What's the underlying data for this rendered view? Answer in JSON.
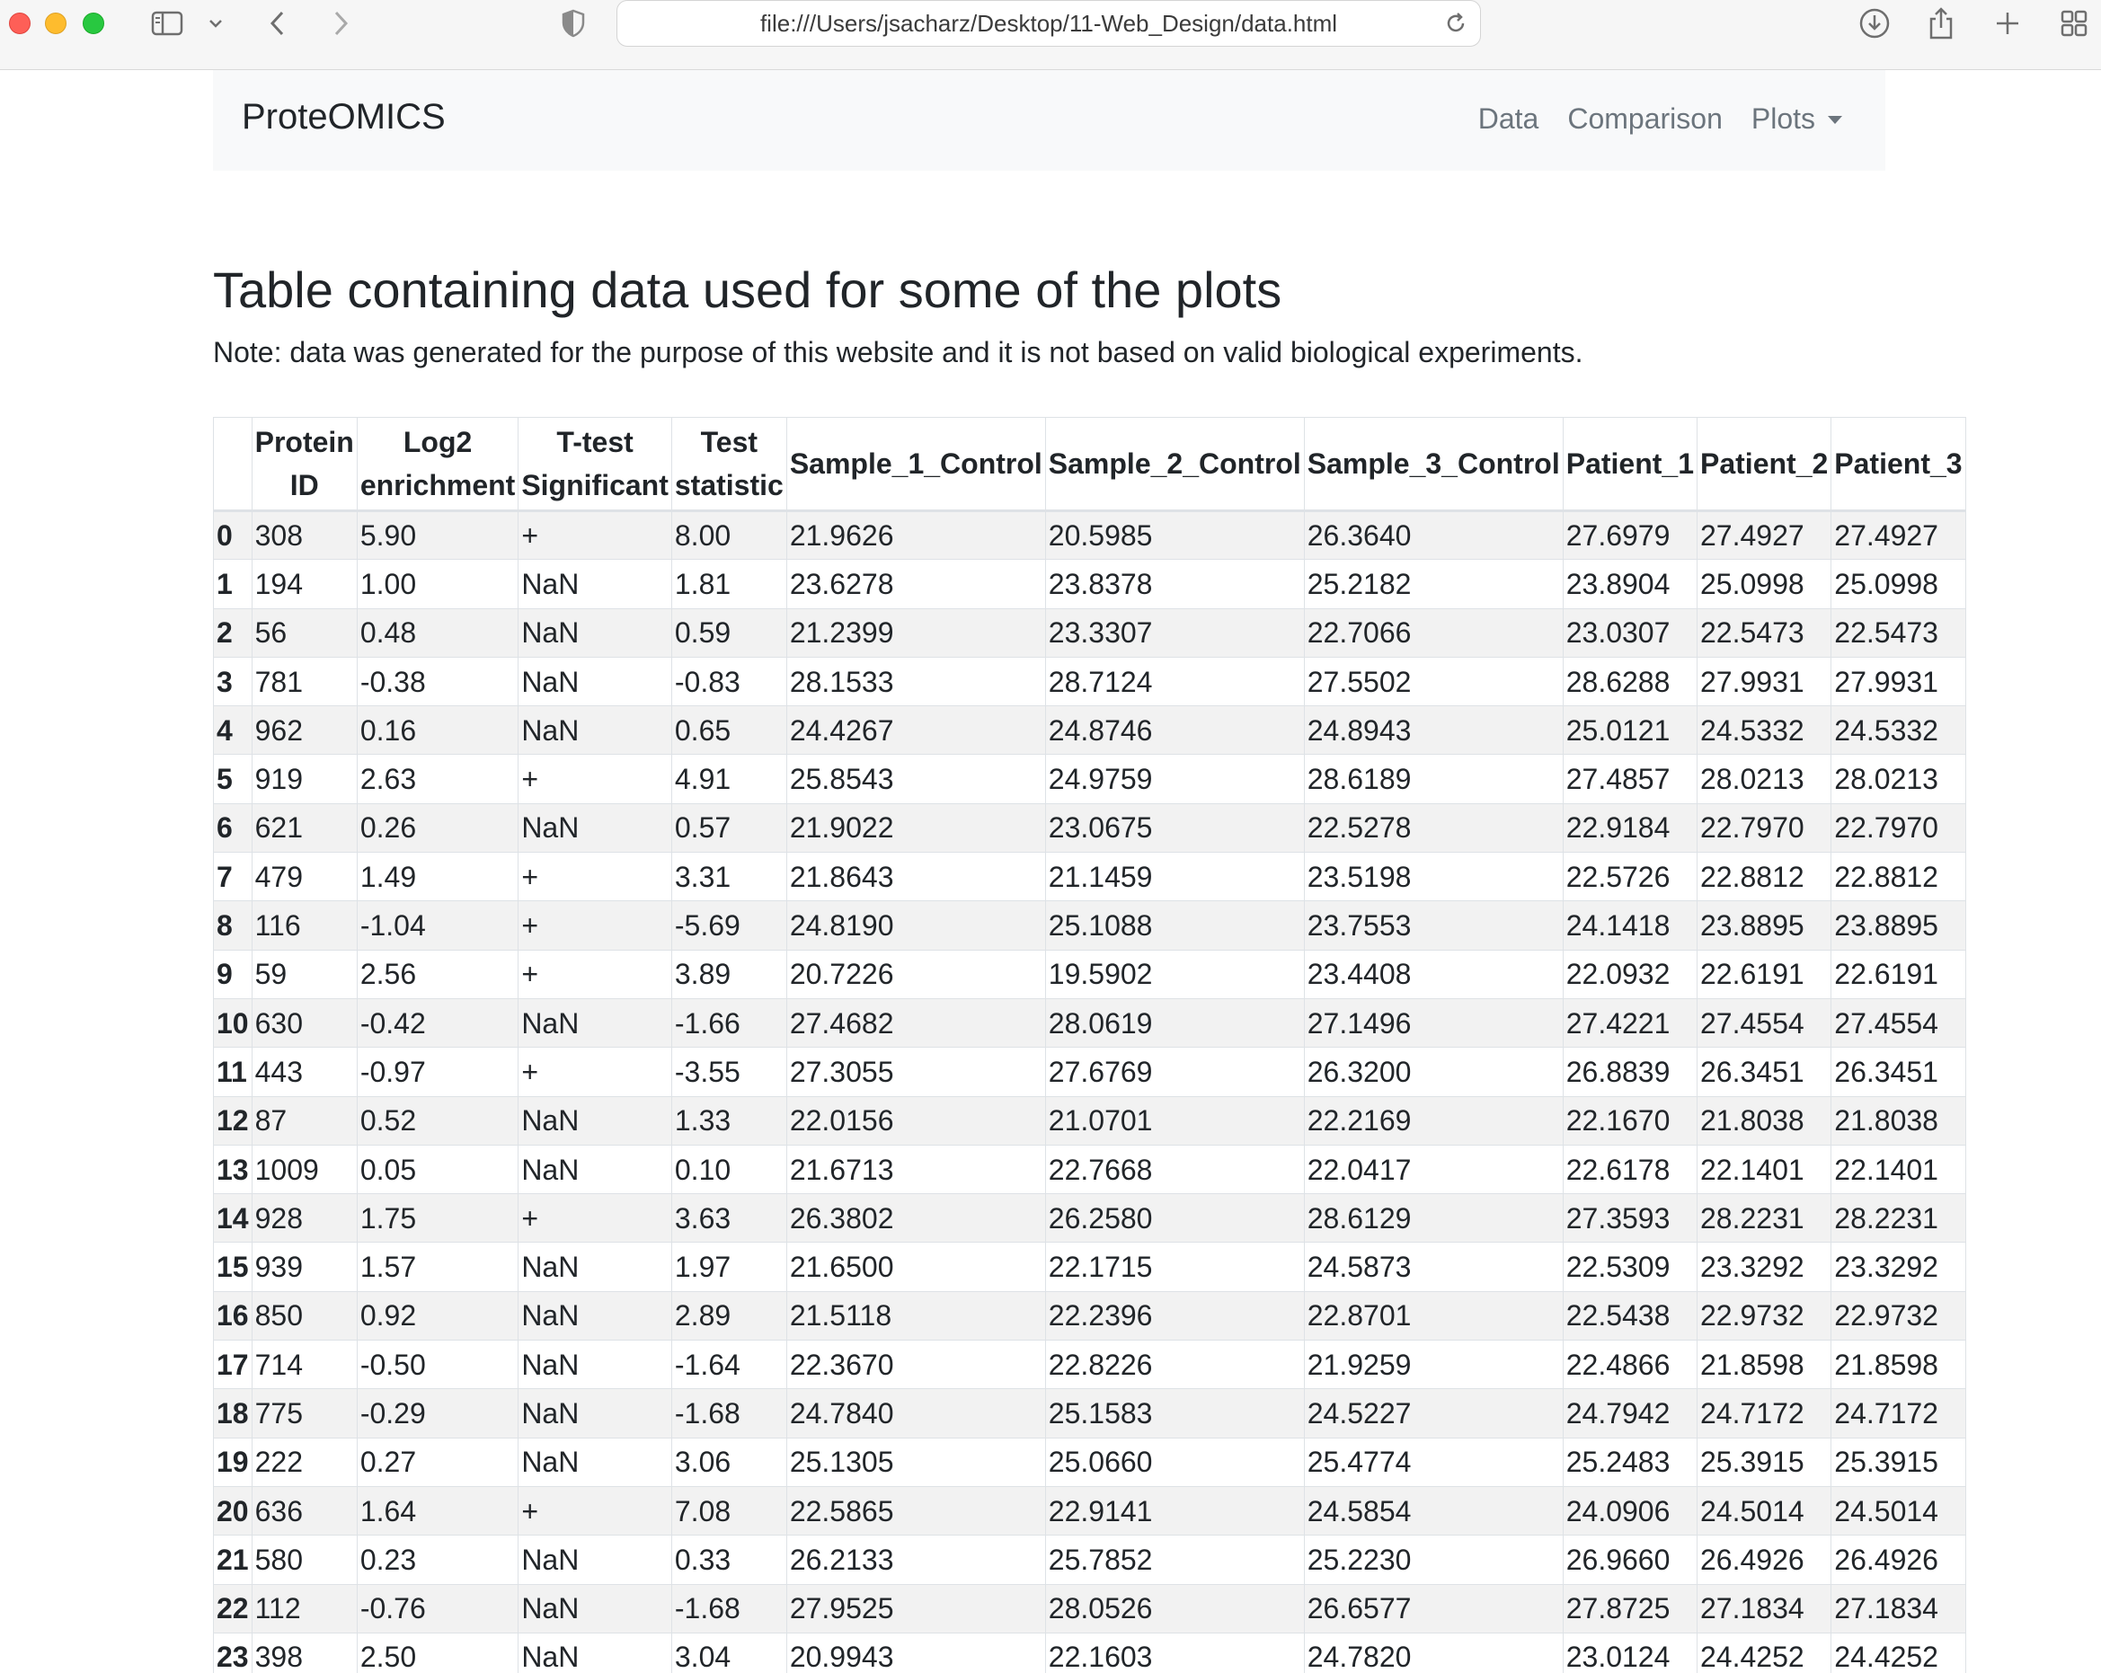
{
  "browser": {
    "url": "file:///Users/jsacharz/Desktop/11-Web_Design/data.html"
  },
  "navbar": {
    "brand": "ProteOMICS",
    "links": [
      "Data",
      "Comparison",
      "Plots"
    ]
  },
  "main": {
    "title": "Table containing data used for some of the plots",
    "note": "Note: data was generated for the purpose of this website and it is not based on valid biological experiments."
  },
  "table": {
    "columns": [
      "",
      "Protein ID",
      "Log2 enrichment",
      "T-test Significant",
      "Test statistic",
      "Sample_1_Control",
      "Sample_2_Control",
      "Sample_3_Control",
      "Patient_1",
      "Patient_2",
      "Patient_3"
    ],
    "column_header_lines": [
      [
        ""
      ],
      [
        "Protein",
        "ID"
      ],
      [
        "Log2",
        "enrichment"
      ],
      [
        "T-test",
        "Significant"
      ],
      [
        "Test",
        "statistic"
      ],
      [
        "Sample_1_Control"
      ],
      [
        "Sample_2_Control"
      ],
      [
        "Sample_3_Control"
      ],
      [
        "Patient_1"
      ],
      [
        "Patient_2"
      ],
      [
        "Patient_3"
      ]
    ],
    "rows": [
      [
        "0",
        "308",
        "5.90",
        "+",
        "8.00",
        "21.9626",
        "20.5985",
        "26.3640",
        "27.6979",
        "27.4927",
        "27.4927"
      ],
      [
        "1",
        "194",
        "1.00",
        "NaN",
        "1.81",
        "23.6278",
        "23.8378",
        "25.2182",
        "23.8904",
        "25.0998",
        "25.0998"
      ],
      [
        "2",
        "56",
        "0.48",
        "NaN",
        "0.59",
        "21.2399",
        "23.3307",
        "22.7066",
        "23.0307",
        "22.5473",
        "22.5473"
      ],
      [
        "3",
        "781",
        "-0.38",
        "NaN",
        "-0.83",
        "28.1533",
        "28.7124",
        "27.5502",
        "28.6288",
        "27.9931",
        "27.9931"
      ],
      [
        "4",
        "962",
        "0.16",
        "NaN",
        "0.65",
        "24.4267",
        "24.8746",
        "24.8943",
        "25.0121",
        "24.5332",
        "24.5332"
      ],
      [
        "5",
        "919",
        "2.63",
        "+",
        "4.91",
        "25.8543",
        "24.9759",
        "28.6189",
        "27.4857",
        "28.0213",
        "28.0213"
      ],
      [
        "6",
        "621",
        "0.26",
        "NaN",
        "0.57",
        "21.9022",
        "23.0675",
        "22.5278",
        "22.9184",
        "22.7970",
        "22.7970"
      ],
      [
        "7",
        "479",
        "1.49",
        "+",
        "3.31",
        "21.8643",
        "21.1459",
        "23.5198",
        "22.5726",
        "22.8812",
        "22.8812"
      ],
      [
        "8",
        "116",
        "-1.04",
        "+",
        "-5.69",
        "24.8190",
        "25.1088",
        "23.7553",
        "24.1418",
        "23.8895",
        "23.8895"
      ],
      [
        "9",
        "59",
        "2.56",
        "+",
        "3.89",
        "20.7226",
        "19.5902",
        "23.4408",
        "22.0932",
        "22.6191",
        "22.6191"
      ],
      [
        "10",
        "630",
        "-0.42",
        "NaN",
        "-1.66",
        "27.4682",
        "28.0619",
        "27.1496",
        "27.4221",
        "27.4554",
        "27.4554"
      ],
      [
        "11",
        "443",
        "-0.97",
        "+",
        "-3.55",
        "27.3055",
        "27.6769",
        "26.3200",
        "26.8839",
        "26.3451",
        "26.3451"
      ],
      [
        "12",
        "87",
        "0.52",
        "NaN",
        "1.33",
        "22.0156",
        "21.0701",
        "22.2169",
        "22.1670",
        "21.8038",
        "21.8038"
      ],
      [
        "13",
        "1009",
        "0.05",
        "NaN",
        "0.10",
        "21.6713",
        "22.7668",
        "22.0417",
        "22.6178",
        "22.1401",
        "22.1401"
      ],
      [
        "14",
        "928",
        "1.75",
        "+",
        "3.63",
        "26.3802",
        "26.2580",
        "28.6129",
        "27.3593",
        "28.2231",
        "28.2231"
      ],
      [
        "15",
        "939",
        "1.57",
        "NaN",
        "1.97",
        "21.6500",
        "22.1715",
        "24.5873",
        "22.5309",
        "23.3292",
        "23.3292"
      ],
      [
        "16",
        "850",
        "0.92",
        "NaN",
        "2.89",
        "21.5118",
        "22.2396",
        "22.8701",
        "22.5438",
        "22.9732",
        "22.9732"
      ],
      [
        "17",
        "714",
        "-0.50",
        "NaN",
        "-1.64",
        "22.3670",
        "22.8226",
        "21.9259",
        "22.4866",
        "21.8598",
        "21.8598"
      ],
      [
        "18",
        "775",
        "-0.29",
        "NaN",
        "-1.68",
        "24.7840",
        "25.1583",
        "24.5227",
        "24.7942",
        "24.7172",
        "24.7172"
      ],
      [
        "19",
        "222",
        "0.27",
        "NaN",
        "3.06",
        "25.1305",
        "25.0660",
        "25.4774",
        "25.2483",
        "25.3915",
        "25.3915"
      ],
      [
        "20",
        "636",
        "1.64",
        "+",
        "7.08",
        "22.5865",
        "22.9141",
        "24.5854",
        "24.0906",
        "24.5014",
        "24.5014"
      ],
      [
        "21",
        "580",
        "0.23",
        "NaN",
        "0.33",
        "26.2133",
        "25.7852",
        "25.2230",
        "26.9660",
        "26.4926",
        "26.4926"
      ],
      [
        "22",
        "112",
        "-0.76",
        "NaN",
        "-1.68",
        "27.9525",
        "28.0526",
        "26.6577",
        "27.8725",
        "27.1834",
        "27.1834"
      ],
      [
        "23",
        "398",
        "2.50",
        "NaN",
        "3.04",
        "20.9943",
        "22.1603",
        "24.7820",
        "23.0124",
        "24.4252",
        "24.4252"
      ]
    ]
  }
}
